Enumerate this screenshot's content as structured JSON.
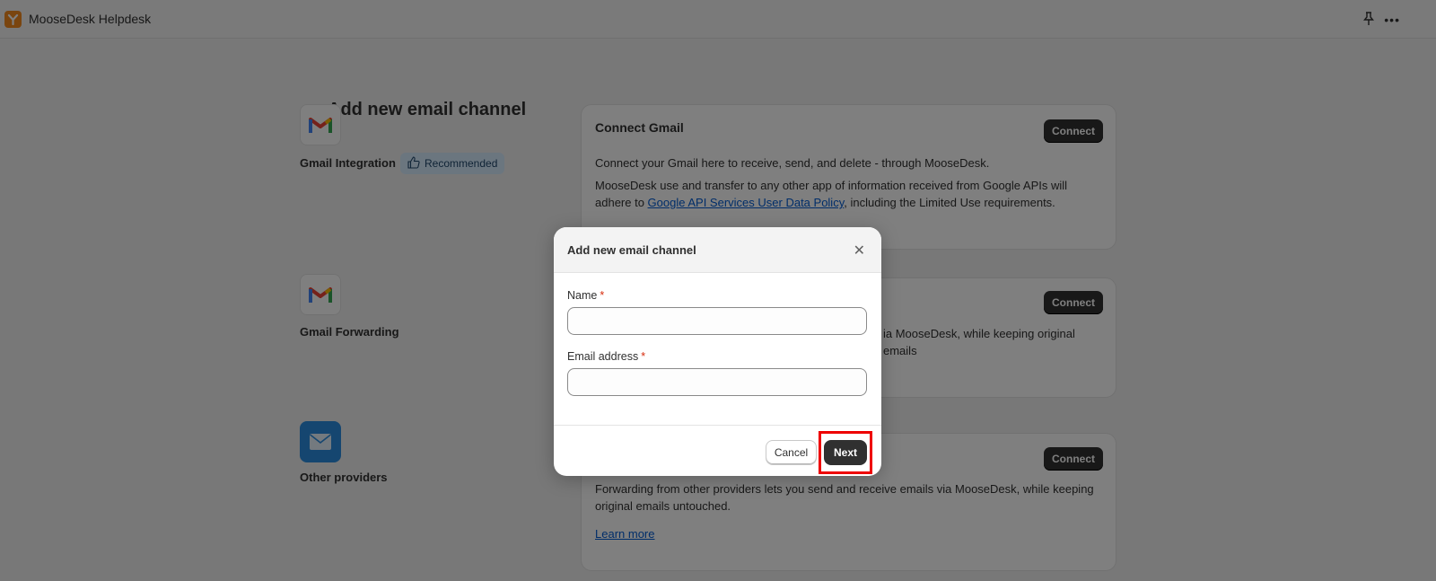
{
  "app": {
    "title": "MooseDesk Helpdesk"
  },
  "page": {
    "title": "Add new email channel"
  },
  "channels": [
    {
      "label": "Gmail Integration",
      "badge": "Recommended"
    },
    {
      "label": "Gmail Forwarding"
    },
    {
      "label": "Other providers"
    }
  ],
  "cards": {
    "gmail_integration": {
      "title": "Connect Gmail",
      "connect_label": "Connect",
      "desc1": "Connect your Gmail here to receive, send, and delete - through MooseDesk.",
      "desc2_part1": "MooseDesk use and transfer to any other app of information received from Google APIs will adhere to ",
      "desc2_link": "Google API Services User Data Policy",
      "desc2_part2": ", including the Limited Use requirements."
    },
    "gmail_forwarding": {
      "connect_label": "Connect",
      "desc_visible": "ia MooseDesk, while keeping original emails"
    },
    "other_providers": {
      "connect_label": "Connect",
      "desc": "Forwarding from other providers lets you send and receive emails via MooseDesk, while keeping original emails untouched.",
      "learn_more": "Learn more"
    }
  },
  "modal": {
    "title": "Add new email channel",
    "name_label": "Name",
    "name_value": "",
    "email_label": "Email address",
    "email_value": "",
    "required_mark": "*",
    "cancel_label": "Cancel",
    "next_label": "Next"
  },
  "colors": {
    "primary_button": "#303030",
    "link": "#005bd3",
    "badge_bg": "#d6ecff",
    "logo": "#f58a1f",
    "highlight": "#ee0000",
    "required": "#d72c0d"
  }
}
